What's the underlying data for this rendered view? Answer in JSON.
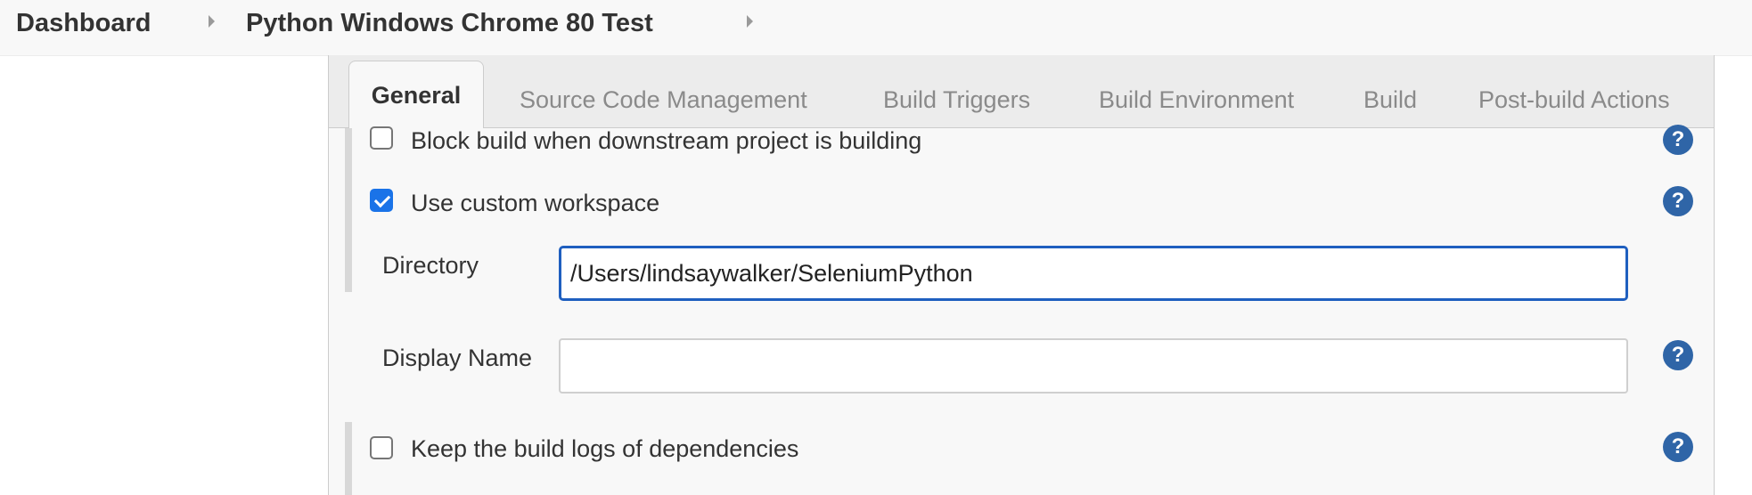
{
  "breadcrumb": {
    "items": [
      "Dashboard",
      "Python Windows Chrome 80 Test"
    ]
  },
  "tabs": [
    {
      "label": "General",
      "active": true
    },
    {
      "label": "Source Code Management",
      "active": false
    },
    {
      "label": "Build Triggers",
      "active": false
    },
    {
      "label": "Build Environment",
      "active": false
    },
    {
      "label": "Build",
      "active": false
    },
    {
      "label": "Post-build Actions",
      "active": false
    }
  ],
  "options": {
    "block_downstream": {
      "label": "Block build when downstream project is building",
      "checked": false
    },
    "custom_workspace": {
      "label": "Use custom workspace",
      "checked": true
    },
    "keep_logs": {
      "label": "Keep the build logs of dependencies",
      "checked": false
    }
  },
  "workspace": {
    "directory": {
      "label": "Directory",
      "value": "/Users/lindsaywalker/SeleniumPython"
    },
    "display_name": {
      "label": "Display Name",
      "value": ""
    }
  },
  "help": {
    "glyph": "?"
  },
  "colors": {
    "accent": "#1a73e8",
    "help": "#2f65a7",
    "focus_border": "#1f5fbf"
  }
}
